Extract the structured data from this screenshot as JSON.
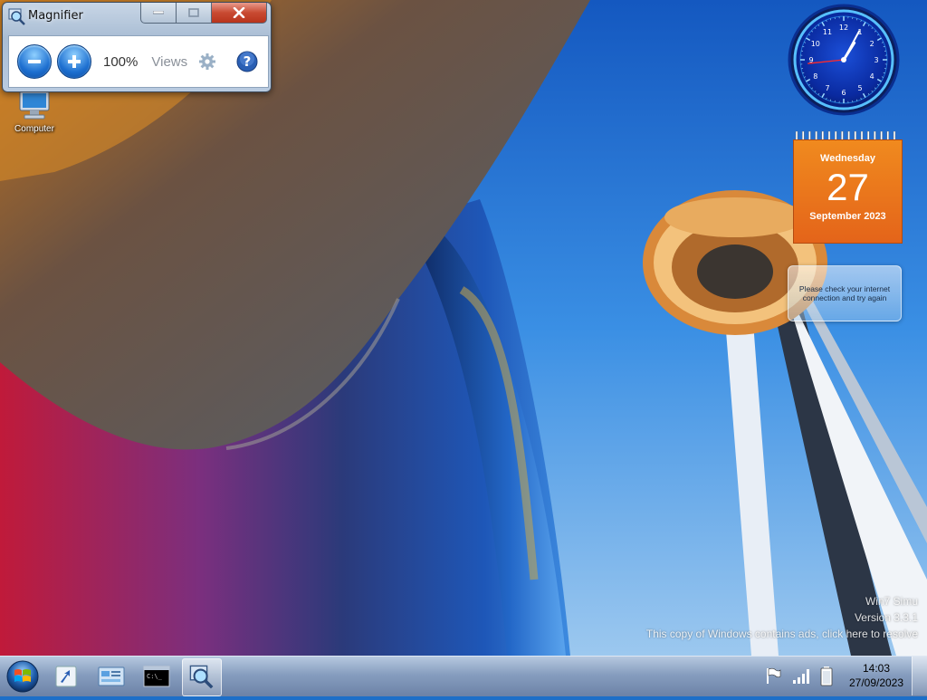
{
  "magnifier": {
    "title": "Magnifier",
    "zoom_level": "100%",
    "views_label": "Views"
  },
  "desktop": {
    "icons": [
      {
        "label": "Computer",
        "icon": "computer-icon"
      }
    ]
  },
  "gadgets": {
    "clock": {
      "hour": 1,
      "minute": 4,
      "second": 44
    },
    "calendar": {
      "day_name": "Wednesday",
      "day_number": "27",
      "month_year": "September 2023"
    },
    "weather": {
      "message": "Please check your internet connection and try again"
    }
  },
  "watermark": {
    "line1": "Win7 Simu",
    "line2": "Version 3.3.1",
    "line3": "This copy of Windows contains ads, click here to resolve"
  },
  "taskbar": {
    "pinned": [
      "start-orb-icon",
      "shortcut-icon",
      "control-panel-icon",
      "command-prompt-icon",
      "magnifier-icon"
    ],
    "tray": [
      "action-center-flag-icon",
      "network-signal-icon",
      "battery-icon"
    ],
    "time": "14:03",
    "date": "27/09/2023"
  },
  "colors": {
    "sky": "#2a7ddd",
    "calendar_orange": "#e86f1c",
    "close_button_red": "#c94a32"
  }
}
